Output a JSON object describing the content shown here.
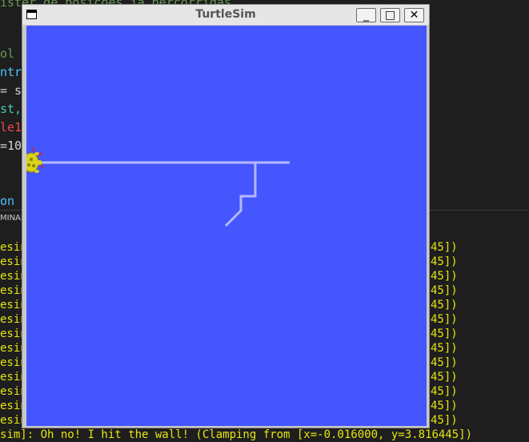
{
  "editor": {
    "lines": [
      {
        "text": "ister de posicoes ja percorridas",
        "color": "#6a9955"
      },
      {
        "text": "ol",
        "color": "#6a9955"
      },
      {
        "text": "ntro",
        "color": "#4fc1ff"
      },
      {
        "text": "= se",
        "color": "#d4d4d4"
      },
      {
        "text": "st,",
        "color": "#4ec9b0"
      },
      {
        "text": "le1",
        "color": "#f44747"
      },
      {
        "text": "=10",
        "color": "#d4d4d4"
      },
      {
        "text": "on =",
        "color": "#4fc1ff"
      }
    ]
  },
  "panel": {
    "terminal_tab": "MINAL"
  },
  "terminal": {
    "line_left": "esin",
    "line_right": "45])",
    "repeat_count": 13,
    "last_line": "sim]: Oh no! I hit the wall! (Clamping from [x=-0.016000, y=3.816445])"
  },
  "window": {
    "title": "TurtleSim",
    "minimize_glyph": "_",
    "maximize_glyph": "□",
    "close_glyph": "✕"
  },
  "turtlesim": {
    "background_color": "#4556ff",
    "pen_color": "#b3b8ff",
    "turtle_color": "#d8d21a"
  }
}
